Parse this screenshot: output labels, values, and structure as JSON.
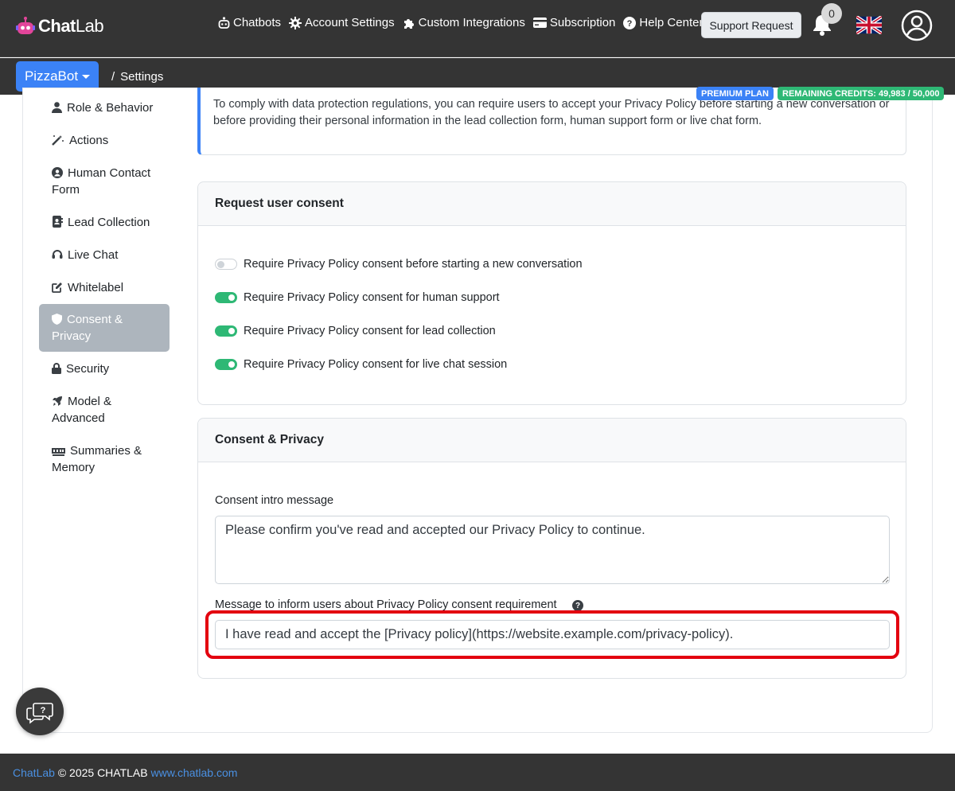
{
  "brand": {
    "name_bold": "Chat",
    "name_light": "Lab"
  },
  "nav": {
    "chatbots": "Chatbots",
    "account_settings": "Account Settings",
    "custom_integrations": "Custom Integrations",
    "subscription": "Subscription",
    "help_center": "Help Center",
    "support_request": "Support Request",
    "notification_count": "0"
  },
  "subnav": {
    "bot_name": "PizzaBot",
    "separator": "/",
    "page": "Settings",
    "plan_badge": "PREMIUM PLAN",
    "credits_badge": "REMAINING CREDITS: 49,983 / 50,000"
  },
  "sidebar": {
    "items": [
      {
        "label": "Role & Behavior",
        "icon": "person-icon"
      },
      {
        "label": "Actions",
        "icon": "magic-wand-icon"
      },
      {
        "label": "Human Contact Form",
        "icon": "user-circle-icon"
      },
      {
        "label": "Lead Collection",
        "icon": "address-book-icon"
      },
      {
        "label": "Live Chat",
        "icon": "headset-icon"
      },
      {
        "label": "Whitelabel",
        "icon": "edit-icon"
      },
      {
        "label": "Consent & Privacy",
        "icon": "shield-icon",
        "active": true
      },
      {
        "label": "Security",
        "icon": "lock-icon"
      },
      {
        "label": "Model & Advanced",
        "icon": "rocket-icon"
      },
      {
        "label": "Summaries & Memory",
        "icon": "memory-icon"
      }
    ]
  },
  "info": {
    "text": "To comply with data protection regulations, you can require users to accept your Privacy Policy before starting a new conversation or before providing their personal information in the lead collection form, human support form or live chat form."
  },
  "consent_card": {
    "title": "Request user consent",
    "toggles": [
      {
        "label": "Require Privacy Policy consent before starting a new conversation",
        "on": false
      },
      {
        "label": "Require Privacy Policy consent for human support",
        "on": true
      },
      {
        "label": "Require Privacy Policy consent for lead collection",
        "on": true
      },
      {
        "label": "Require Privacy Policy consent for live chat session",
        "on": true
      }
    ]
  },
  "privacy_card": {
    "title": "Consent & Privacy",
    "intro_label": "Consent intro message",
    "intro_value": "Please confirm you've read and accepted our Privacy Policy to continue.",
    "requirement_label": "Message to inform users about Privacy Policy consent requirement",
    "requirement_value": "I have read and accept the [Privacy policy](https://website.example.com/privacy-policy)."
  },
  "footer": {
    "brand": "ChatLab",
    "copyright": " © 2025 CHATLAB ",
    "url": "www.chatlab.com"
  },
  "colors": {
    "nav_bg": "#343434",
    "accent_blue": "#3b82f6",
    "toggle_green": "#2eb875",
    "highlight_red": "#e3000f"
  }
}
